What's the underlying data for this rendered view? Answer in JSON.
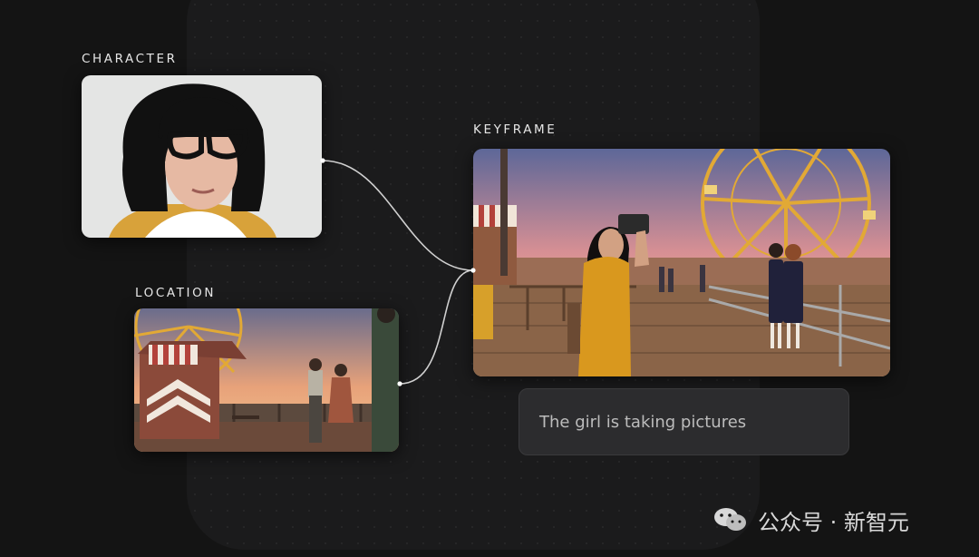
{
  "labels": {
    "character": "CHARACTER",
    "location": "LOCATION",
    "keyframe": "KEYFRAME"
  },
  "prompt": {
    "text": "The girl is taking pictures"
  },
  "watermark": {
    "text": "公众号 · 新智元"
  },
  "colors": {
    "background": "#141414",
    "panel": "#1b1b1c",
    "prompt_bg": "#2c2c2e",
    "connector": "#d0d0d0",
    "dress": "#d9981e"
  }
}
